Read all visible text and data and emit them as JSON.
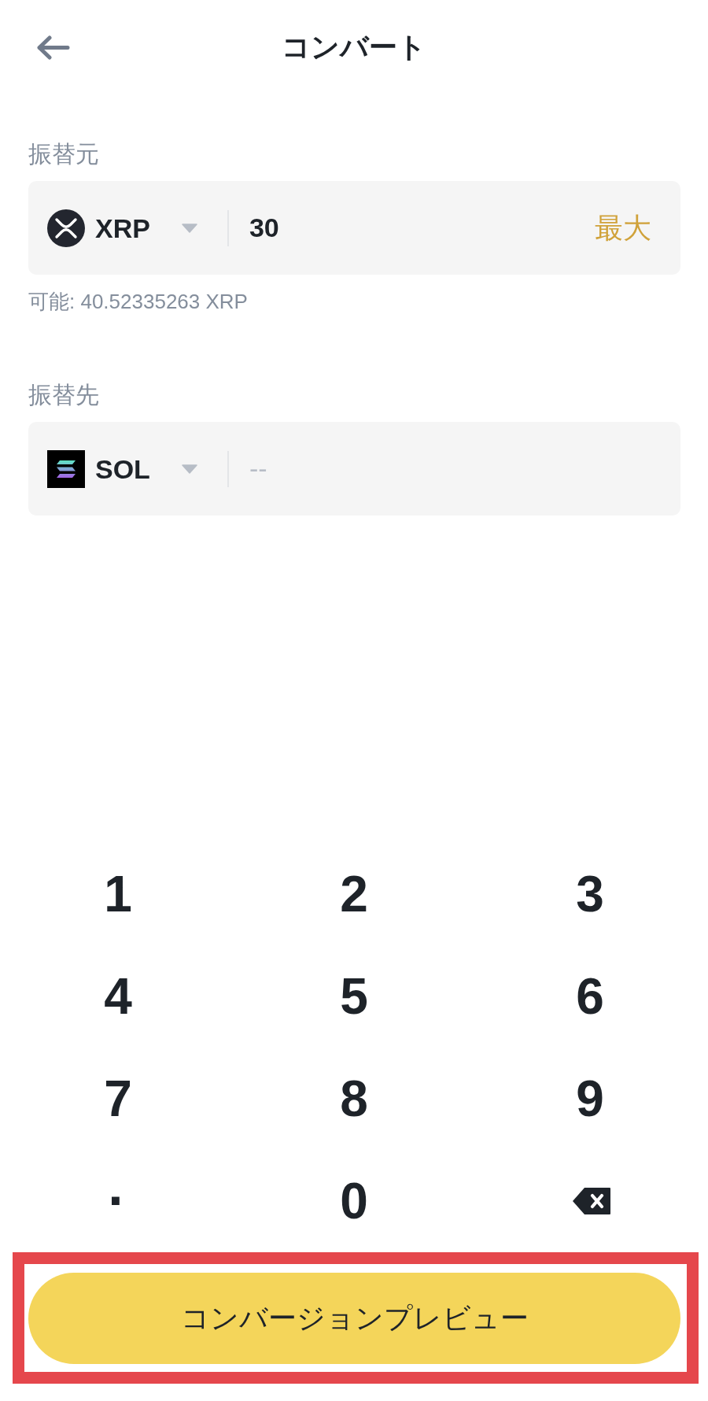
{
  "header": {
    "title": "コンバート"
  },
  "from": {
    "label": "振替元",
    "coin": "XRP",
    "value": "30",
    "max_label": "最大",
    "available": "可能: 40.52335263 XRP"
  },
  "to": {
    "label": "振替先",
    "coin": "SOL",
    "placeholder": "--"
  },
  "keypad": {
    "keys": [
      {
        "kind": "digit",
        "label": "1"
      },
      {
        "kind": "digit",
        "label": "2"
      },
      {
        "kind": "digit",
        "label": "3"
      },
      {
        "kind": "digit",
        "label": "4"
      },
      {
        "kind": "digit",
        "label": "5"
      },
      {
        "kind": "digit",
        "label": "6"
      },
      {
        "kind": "digit",
        "label": "7"
      },
      {
        "kind": "digit",
        "label": "8"
      },
      {
        "kind": "digit",
        "label": "9"
      },
      {
        "kind": "decimal",
        "label": "·"
      },
      {
        "kind": "digit",
        "label": "0"
      },
      {
        "kind": "backspace"
      }
    ]
  },
  "preview_button": {
    "label": "コンバージョンプレビュー",
    "highlighted": true
  }
}
